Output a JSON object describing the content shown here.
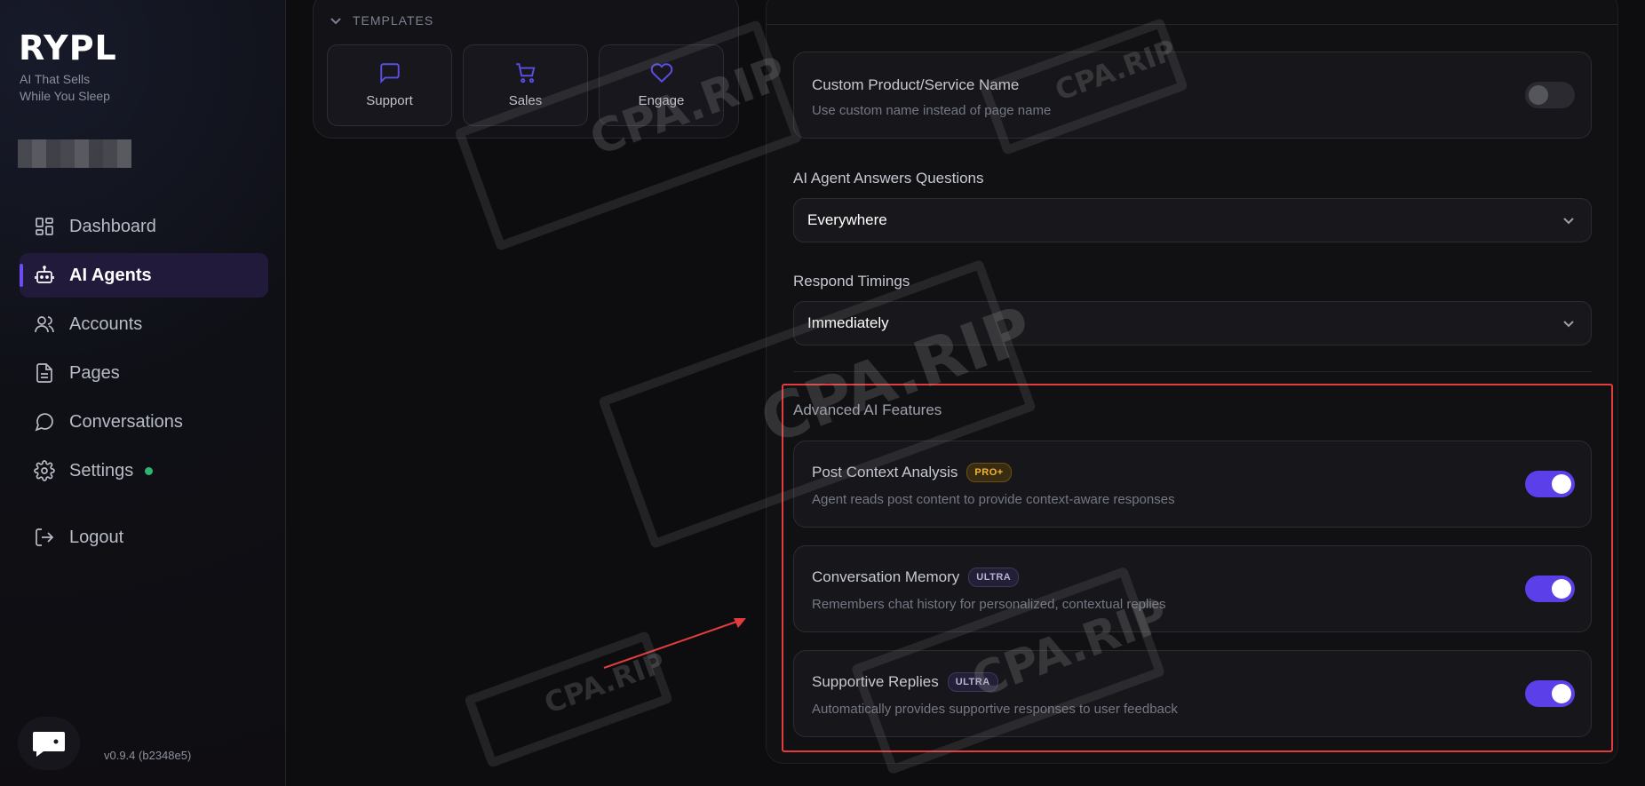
{
  "brand": {
    "logo": "RYPL",
    "tagline_line1": "AI That Sells",
    "tagline_line2": "While You Sleep"
  },
  "sidebar": {
    "items": [
      {
        "label": "Dashboard",
        "icon": "grid-icon"
      },
      {
        "label": "AI Agents",
        "icon": "robot-icon",
        "active": true
      },
      {
        "label": "Accounts",
        "icon": "users-icon"
      },
      {
        "label": "Pages",
        "icon": "page-icon"
      },
      {
        "label": "Conversations",
        "icon": "chat-bubble-icon"
      },
      {
        "label": "Settings",
        "icon": "gear-icon",
        "status_dot": "#2bb673"
      }
    ],
    "logout_label": "Logout",
    "version": "v0.9.4 (b2348e5)"
  },
  "templates": {
    "heading": "TEMPLATES",
    "items": [
      {
        "label": "Support",
        "icon": "chat-bubble-icon"
      },
      {
        "label": "Sales",
        "icon": "cart-icon"
      },
      {
        "label": "Engage",
        "icon": "heart-icon"
      }
    ]
  },
  "settings": {
    "custom_name": {
      "title": "Custom Product/Service Name",
      "description": "Use custom name instead of page name",
      "enabled": false
    },
    "answers_questions": {
      "label": "AI Agent Answers Questions",
      "value": "Everywhere"
    },
    "respond_timings": {
      "label": "Respond Timings",
      "value": "Immediately"
    },
    "advanced": {
      "title": "Advanced AI Features",
      "features": [
        {
          "title": "Post Context Analysis",
          "badge": "PRO+",
          "description": "Agent reads post content to provide context-aware responses",
          "enabled": true
        },
        {
          "title": "Conversation Memory",
          "badge": "ULTRA",
          "description": "Remembers chat history for personalized, contextual replies",
          "enabled": true
        },
        {
          "title": "Supportive Replies",
          "badge": "ULTRA",
          "description": "Automatically provides supportive responses to user feedback",
          "enabled": true
        }
      ]
    }
  },
  "watermark": "CPA.RIP",
  "colors": {
    "accent": "#5b3fe8",
    "highlight": "#e23c3c",
    "pro_badge": "#f1b533"
  }
}
